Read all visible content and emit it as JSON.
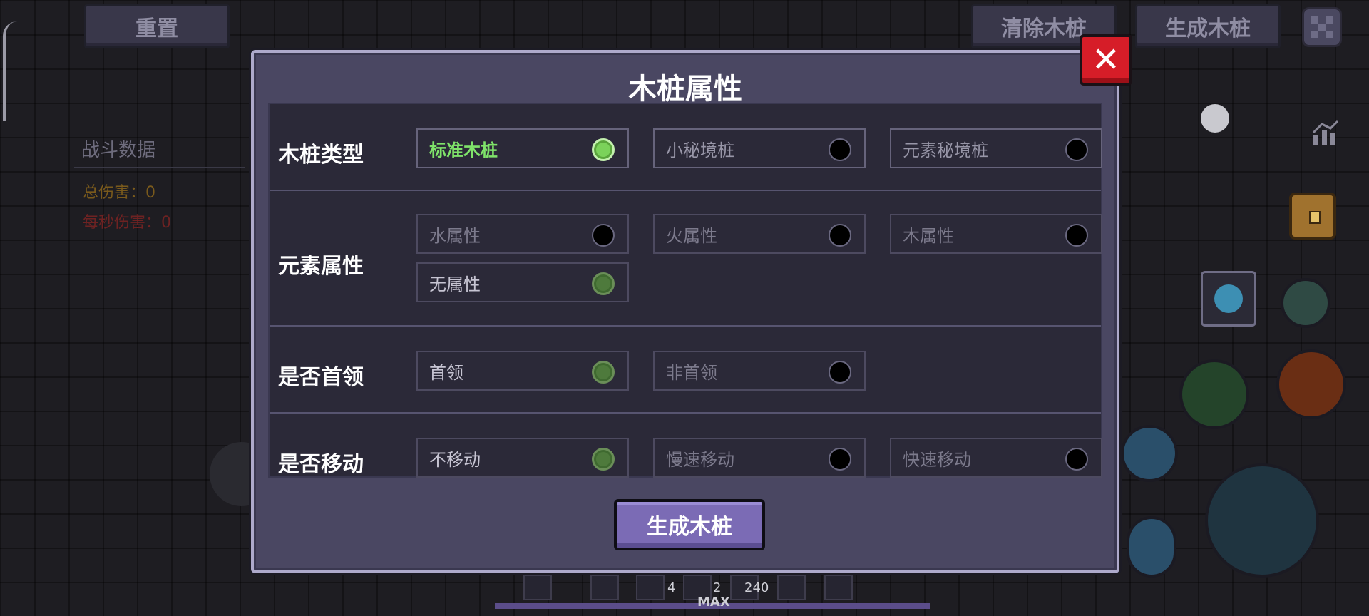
{
  "top_bar": {
    "reset_label": "重置",
    "clear_label": "清除木桩",
    "generate_label": "生成木桩"
  },
  "battle_stats": {
    "title": "战斗数据",
    "total_damage": "总伤害：0",
    "dps": "每秒伤害：0"
  },
  "modal": {
    "title": "木桩属性",
    "close_symbol": "✕",
    "generate_button": "生成木桩",
    "rows": [
      {
        "label": "木桩类型",
        "options": [
          {
            "label": "标准木桩",
            "selected": true
          },
          {
            "label": "小秘境桩",
            "selected": false
          },
          {
            "label": "元素秘境桩",
            "selected": false
          }
        ]
      },
      {
        "label": "元素属性",
        "options": [
          {
            "label": "水属性",
            "selected": false
          },
          {
            "label": "火属性",
            "selected": false
          },
          {
            "label": "木属性",
            "selected": false
          },
          {
            "label": "无属性",
            "selected": true
          }
        ]
      },
      {
        "label": "是否首领",
        "options": [
          {
            "label": "首领",
            "selected": true
          },
          {
            "label": "非首领",
            "selected": false
          }
        ]
      },
      {
        "label": "是否移动",
        "options": [
          {
            "label": "不移动",
            "selected": true
          },
          {
            "label": "慢速移动",
            "selected": false
          },
          {
            "label": "快速移动",
            "selected": false
          }
        ]
      }
    ]
  },
  "hotbar": {
    "counts": [
      "4",
      "2",
      "240"
    ],
    "max_label": "MAX"
  },
  "icons": [
    "menu-icon",
    "chart-icon",
    "chest-icon",
    "gem-icon",
    "close-icon"
  ],
  "colors": {
    "accent_purple": "#7b6bb5",
    "selected_green": "#7fe36a",
    "close_red": "#d61d28"
  }
}
